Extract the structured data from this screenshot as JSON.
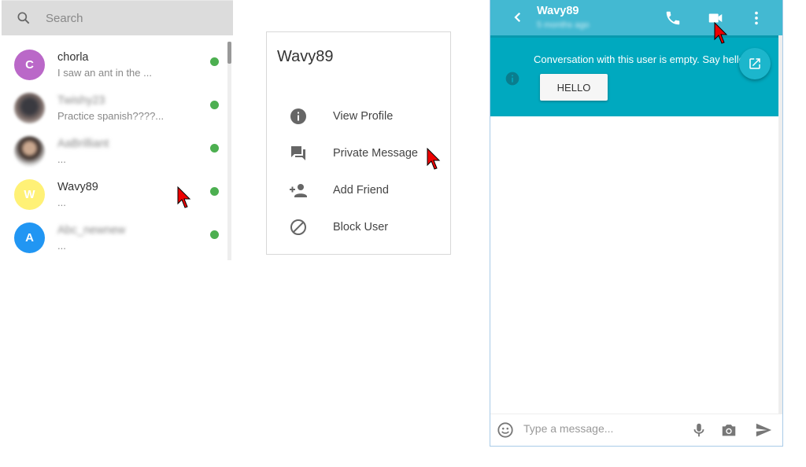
{
  "contacts": {
    "search_placeholder": "Search",
    "items": [
      {
        "name": "chorla",
        "preview": "I saw an ant in the ...",
        "avatar_letter": "C",
        "avatar_color": "#ba68c8",
        "online": true,
        "blurred_name": false
      },
      {
        "name": "Twishy23",
        "preview": "Practice spanish????...",
        "avatar_letter": "",
        "avatar_color": "photo",
        "online": true,
        "blurred_name": true
      },
      {
        "name": "AaBrilliant",
        "preview": "...",
        "avatar_letter": "",
        "avatar_color": "photo",
        "online": true,
        "blurred_name": true
      },
      {
        "name": "Wavy89",
        "preview": "...",
        "avatar_letter": "W",
        "avatar_color": "#fff176",
        "online": true,
        "blurred_name": false
      },
      {
        "name": "Abc_newnew",
        "preview": "...",
        "avatar_letter": "A",
        "avatar_color": "#2196f3",
        "online": true,
        "blurred_name": true
      }
    ],
    "online_color": "#4caf50"
  },
  "user_menu": {
    "title": "Wavy89",
    "items": [
      {
        "label": "View Profile",
        "icon": "info-icon"
      },
      {
        "label": "Private Message",
        "icon": "forum-icon"
      },
      {
        "label": "Add Friend",
        "icon": "person-add-icon"
      },
      {
        "label": "Block User",
        "icon": "block-icon"
      }
    ]
  },
  "chat": {
    "header": {
      "name": "Wavy89",
      "status": "5 months ago",
      "color": "#43b9d2"
    },
    "banner": {
      "message": "Conversation with this user is empty. Say hello!",
      "button_label": "HELLO",
      "color": "#00a9bf"
    },
    "composer": {
      "placeholder": "Type a message..."
    }
  }
}
